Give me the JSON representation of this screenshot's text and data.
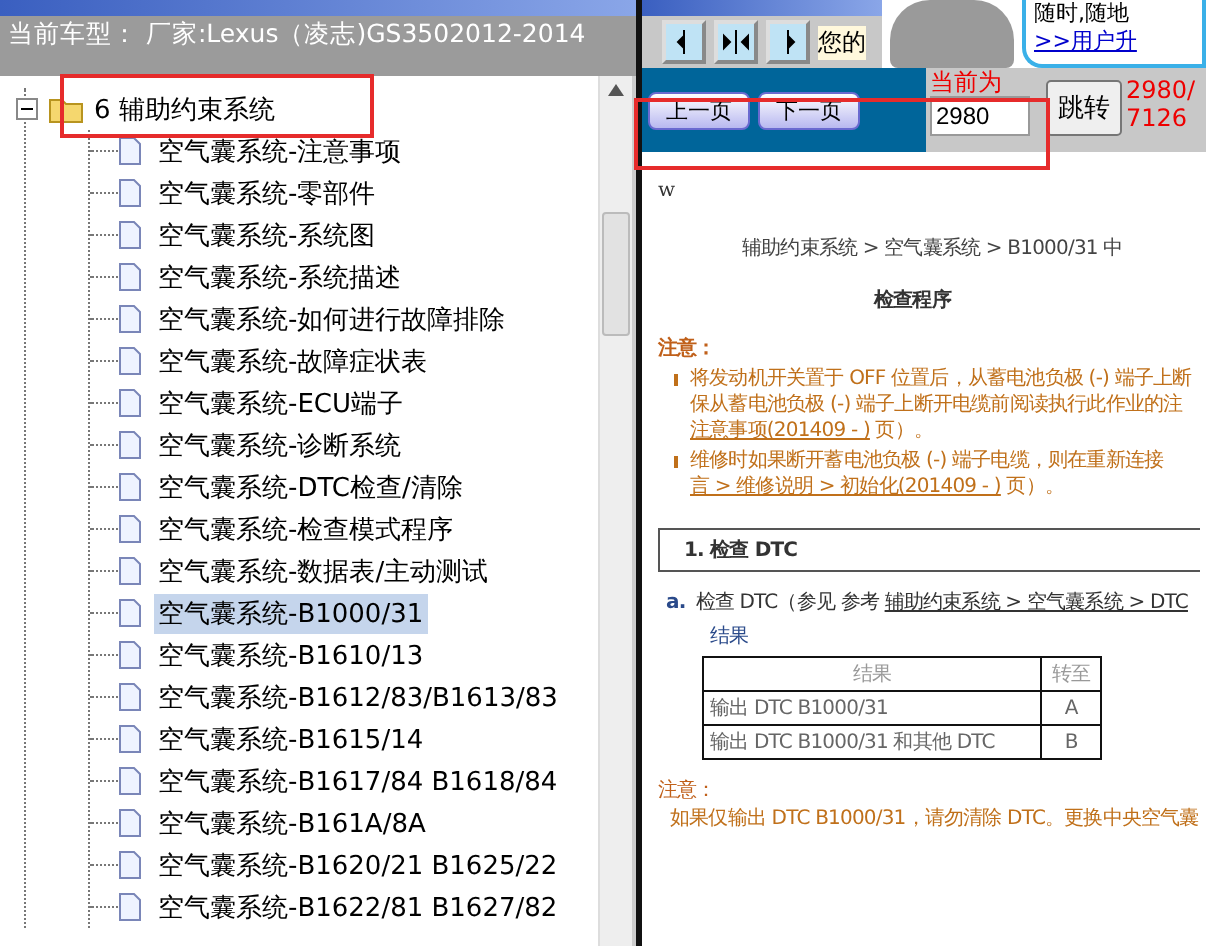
{
  "header": {
    "title": "当前车型： 厂家:Lexus（凌志)GS3502012-2014"
  },
  "tree": {
    "folder": {
      "label": "6 辅助约束系统",
      "expanded": true
    },
    "items": [
      {
        "label": "空气囊系统-注意事项",
        "selected": false
      },
      {
        "label": "空气囊系统-零部件",
        "selected": false
      },
      {
        "label": "空气囊系统-系统图",
        "selected": false
      },
      {
        "label": "空气囊系统-系统描述",
        "selected": false
      },
      {
        "label": "空气囊系统-如何进行故障排除",
        "selected": false
      },
      {
        "label": "空气囊系统-故障症状表",
        "selected": false
      },
      {
        "label": "空气囊系统-ECU端子",
        "selected": false
      },
      {
        "label": "空气囊系统-诊断系统",
        "selected": false
      },
      {
        "label": "空气囊系统-DTC检查/清除",
        "selected": false
      },
      {
        "label": "空气囊系统-检查模式程序",
        "selected": false
      },
      {
        "label": "空气囊系统-数据表/主动测试",
        "selected": false
      },
      {
        "label": "空气囊系统-B1000/31",
        "selected": true
      },
      {
        "label": "空气囊系统-B1610/13",
        "selected": false
      },
      {
        "label": "空气囊系统-B1612/83/B1613/83",
        "selected": false
      },
      {
        "label": "空气囊系统-B1615/14",
        "selected": false
      },
      {
        "label": "空气囊系统-B1617/84 B1618/84",
        "selected": false
      },
      {
        "label": "空气囊系统-B161A/8A",
        "selected": false
      },
      {
        "label": "空气囊系统-B1620/21 B1625/22",
        "selected": false
      },
      {
        "label": "空气囊系统-B1622/81 B1627/82",
        "selected": false
      }
    ]
  },
  "toolbar": {
    "text": "您的",
    "ad_text": "随时,随地",
    "ad_link": ">>用户升"
  },
  "nav": {
    "prev": "上一页",
    "next": "下一页",
    "current_label": "当前为",
    "page_value": "2980",
    "go": "跳转",
    "count": "2980/7126"
  },
  "document": {
    "mark": "w",
    "breadcrumb": "辅助约束系统 > 空气囊系统 > B1000/31 中",
    "heading": "检查程序",
    "notice_title": "注意：",
    "bullets": [
      {
        "lines": [
          "将发动机开关置于 OFF 位置后，从蓄电池负极 (-) 端子上断",
          "保从蓄电池负极 (-) 端子上断开电缆前阅读执行此作业的注"
        ],
        "link": "注意事项(201409 - )",
        "tail": " 页）。"
      },
      {
        "lines": [
          "维修时如果断开蓄电池负极 (-) 端子电缆，则在重新连接"
        ],
        "link": "言 > 维修说明 > 初始化(201409 - )",
        "tail": " 页）。"
      }
    ],
    "step": "1. 检查 DTC",
    "substep_letter": "a.",
    "substep_text": "检查 DTC（参见 参考 ",
    "substep_link": "辅助约束系统 > 空气囊系统 > DTC",
    "result_title": "结果",
    "table": {
      "columns": [
        "结果",
        "转至"
      ],
      "rows": [
        [
          "输出 DTC B1000/31",
          "A"
        ],
        [
          "输出 DTC B1000/31 和其他 DTC",
          "B"
        ]
      ]
    },
    "notice2_title": "注意：",
    "notice2_text": "如果仅输出 DTC B1000/31，请勿清除 DTC。更换中央空气囊"
  }
}
